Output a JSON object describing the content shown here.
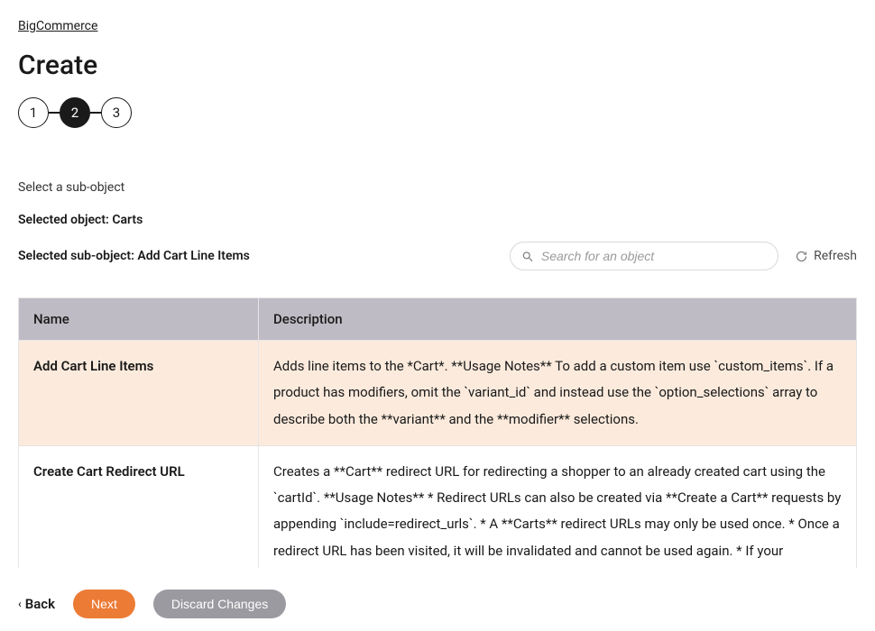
{
  "breadcrumb": {
    "label": "BigCommerce"
  },
  "page": {
    "title": "Create"
  },
  "stepper": {
    "steps": [
      "1",
      "2",
      "3"
    ],
    "active_index": 1
  },
  "instruction": "Select a sub-object",
  "selected": {
    "object_label": "Selected object: Carts",
    "subobject_label": "Selected sub-object: Add Cart Line Items"
  },
  "search": {
    "placeholder": "Search for an object"
  },
  "refresh": {
    "label": "Refresh"
  },
  "table": {
    "columns": [
      "Name",
      "Description"
    ],
    "rows": [
      {
        "name": "Add Cart Line Items",
        "description": "Adds line items to the *Cart*. **Usage Notes** To add a custom item use `custom_items`. If a product has modifiers, omit the `variant_id` and instead use the `option_selections` array to describe both the **variant** and the **modifier** selections.",
        "selected": true
      },
      {
        "name": "Create Cart Redirect URL",
        "description": "Creates a **Cart** redirect URL for redirecting a shopper to an already created cart using the `cartId`. **Usage Notes** * Redirect URLs can also be created via **Create a Cart** requests by appending `include=redirect_urls`. * A **Carts** redirect URLs may only be used once. * Once a redirect URL has been visited, it will be invalidated and cannot be used again. * If your application",
        "selected": false
      }
    ]
  },
  "footer": {
    "back": "Back",
    "next": "Next",
    "discard": "Discard Changes"
  }
}
